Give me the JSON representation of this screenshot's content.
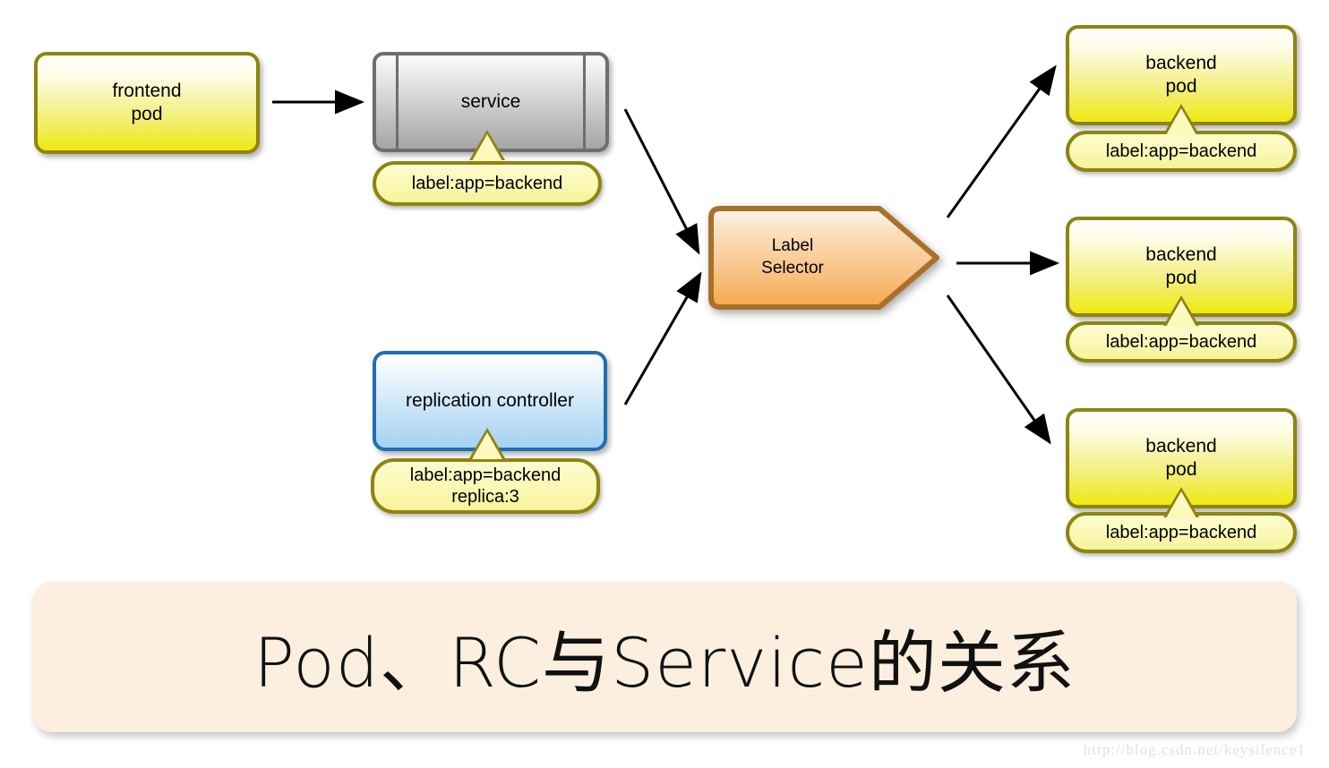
{
  "diagram": {
    "title": "Pod、RC与Service的关系",
    "watermark": "http://blog.csdn.net/keysilence1",
    "colors": {
      "pod_fill_top": "#ffffff",
      "pod_fill_bottom": "#eeea10",
      "pod_border": "#8f8410",
      "service_fill_top": "#fafafa",
      "service_fill_bottom": "#a6a6a6",
      "service_border": "#6e6e6e",
      "rc_fill_top": "#ffffff",
      "rc_fill_bottom": "#a7d2f2",
      "rc_border": "#1f6eb4",
      "selector_fill_top": "#fdf3e7",
      "selector_fill_bottom": "#f6a94a",
      "selector_border": "#a8702a",
      "callout_fill": "#fbf8b6",
      "callout_border": "#8f8410",
      "banner_fill": "#fcefdf",
      "arrow": "#000000"
    },
    "nodes": {
      "frontend_pod": {
        "label": "frontend\npod",
        "shape": "rounded-rect"
      },
      "service": {
        "label": "service",
        "shape": "process"
      },
      "service_callout": {
        "label": "label:app=backend",
        "shape": "callout"
      },
      "replication_controller": {
        "label": "replication controller",
        "shape": "rounded-rect"
      },
      "rc_callout": {
        "label": "label:app=backend\nreplica:3",
        "shape": "callout"
      },
      "label_selector": {
        "label": "Label\nSelector",
        "shape": "pentagon-arrow"
      },
      "backend_pod_1": {
        "label": "backend\npod",
        "shape": "rounded-rect"
      },
      "backend_pod_1_callout": {
        "label": "label:app=backend",
        "shape": "callout"
      },
      "backend_pod_2": {
        "label": "backend\npod",
        "shape": "rounded-rect"
      },
      "backend_pod_2_callout": {
        "label": "label:app=backend",
        "shape": "callout"
      },
      "backend_pod_3": {
        "label": "backend\npod",
        "shape": "rounded-rect"
      },
      "backend_pod_3_callout": {
        "label": "label:app=backend",
        "shape": "callout"
      }
    },
    "edges": [
      {
        "id": "frontend-to-service",
        "from": "frontend_pod",
        "to": "service",
        "style": "solid-arrow"
      },
      {
        "id": "service-to-selector",
        "from": "service",
        "to": "label_selector",
        "style": "solid-arrow"
      },
      {
        "id": "rc-to-selector",
        "from": "replication_controller",
        "to": "label_selector",
        "style": "solid-arrow"
      },
      {
        "id": "selector-to-backend-1",
        "from": "label_selector",
        "to": "backend_pod_1",
        "style": "solid-arrow"
      },
      {
        "id": "selector-to-backend-2",
        "from": "label_selector",
        "to": "backend_pod_2",
        "style": "solid-arrow"
      },
      {
        "id": "selector-to-backend-3",
        "from": "label_selector",
        "to": "backend_pod_3",
        "style": "solid-arrow"
      }
    ]
  }
}
